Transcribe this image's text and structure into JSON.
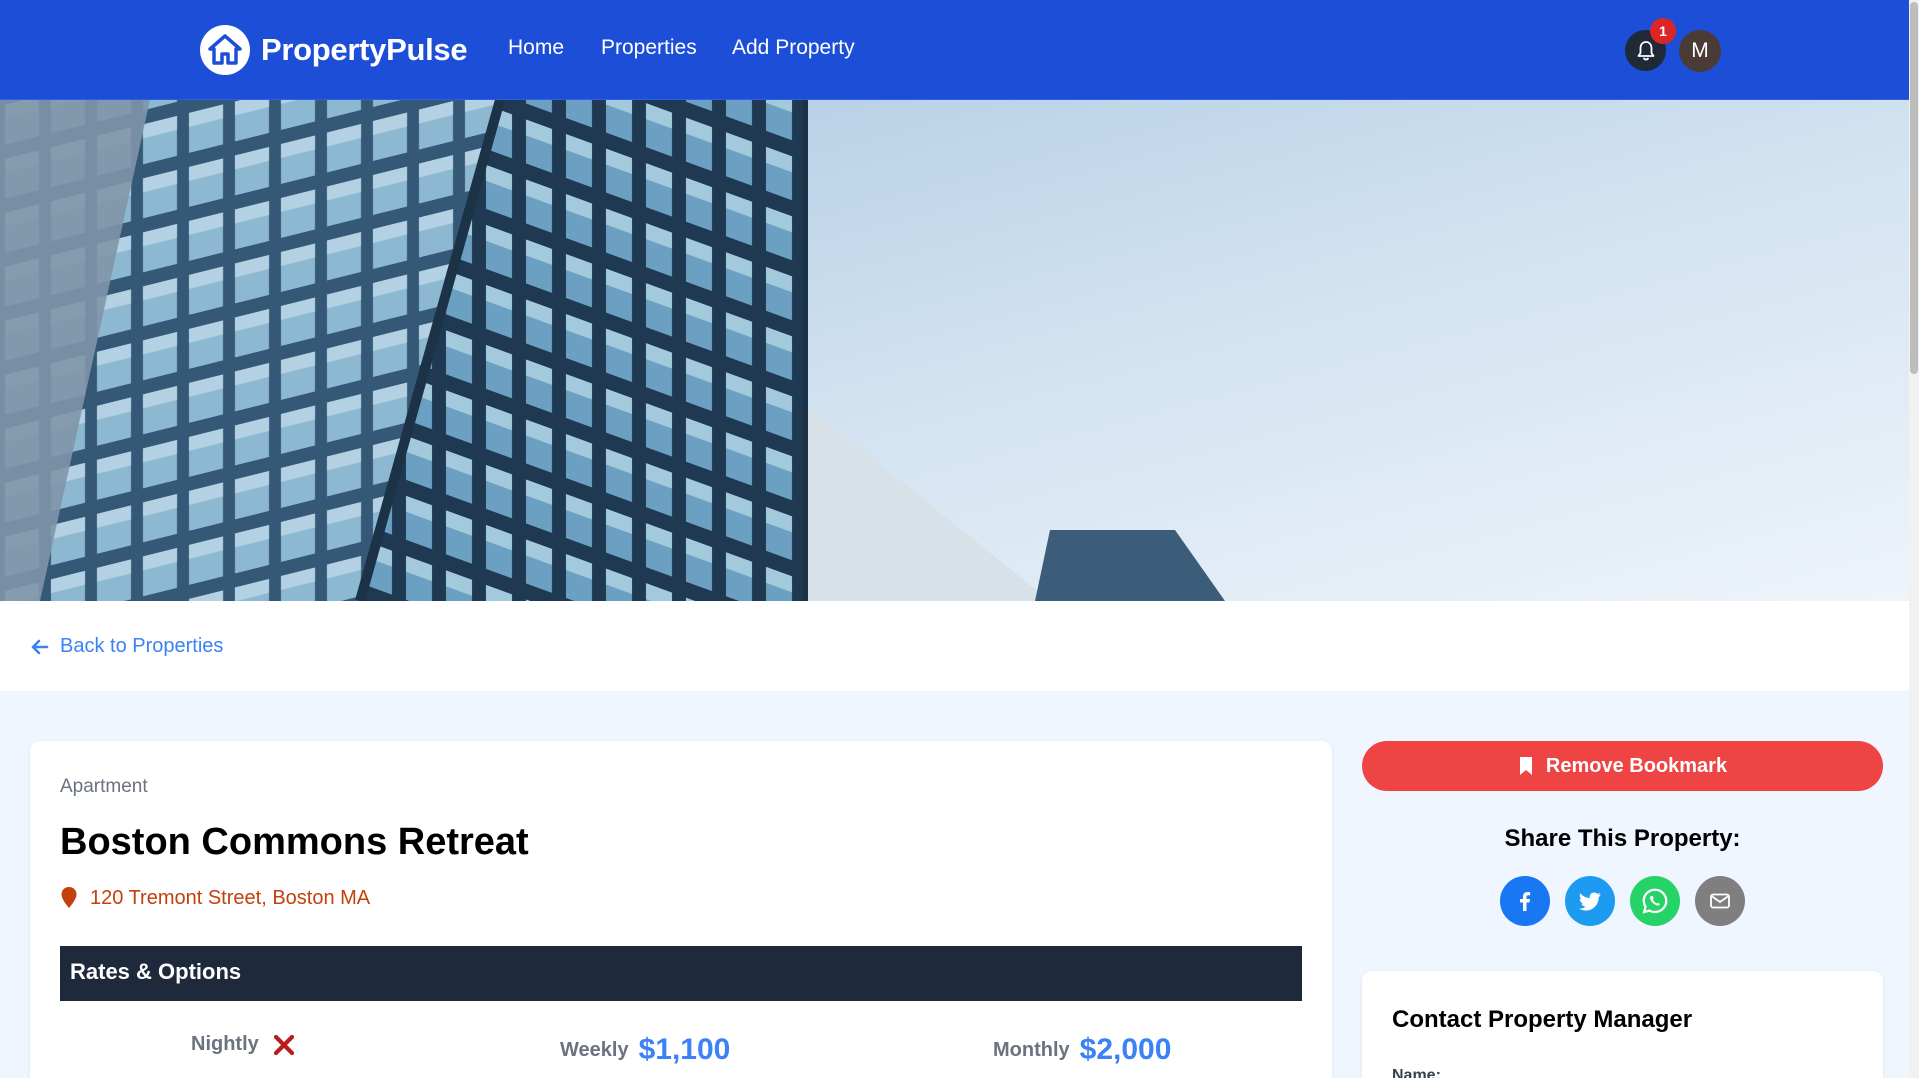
{
  "brand": {
    "name": "PropertyPulse"
  },
  "nav": {
    "home": "Home",
    "properties": "Properties",
    "add_property": "Add Property",
    "notification_count": "1",
    "avatar_initial": "M"
  },
  "back_link": {
    "label": "Back to Properties"
  },
  "property": {
    "type": "Apartment",
    "name": "Boston Commons Retreat",
    "address": "120 Tremont Street, Boston MA"
  },
  "rates": {
    "heading": "Rates & Options",
    "nightly": {
      "label": "Nightly",
      "available": false
    },
    "weekly": {
      "label": "Weekly",
      "value": "$1,100"
    },
    "monthly": {
      "label": "Monthly",
      "value": "$2,000"
    }
  },
  "sidebar": {
    "bookmark_button": "Remove Bookmark",
    "share_title": "Share This Property:",
    "share_icons": [
      "facebook-icon",
      "twitter-icon",
      "whatsapp-icon",
      "email-icon"
    ],
    "contact_title": "Contact Property Manager",
    "name_label": "Name:"
  },
  "colors": {
    "navbar": "#1d4ed8",
    "accent": "#3b82f6",
    "danger": "#ef4444",
    "address": "#c2410c",
    "rates_bar": "#1e293b",
    "facebook": "#1877f2",
    "twitter": "#1d9bf0",
    "whatsapp": "#25d366",
    "email": "#7f7f7f"
  }
}
